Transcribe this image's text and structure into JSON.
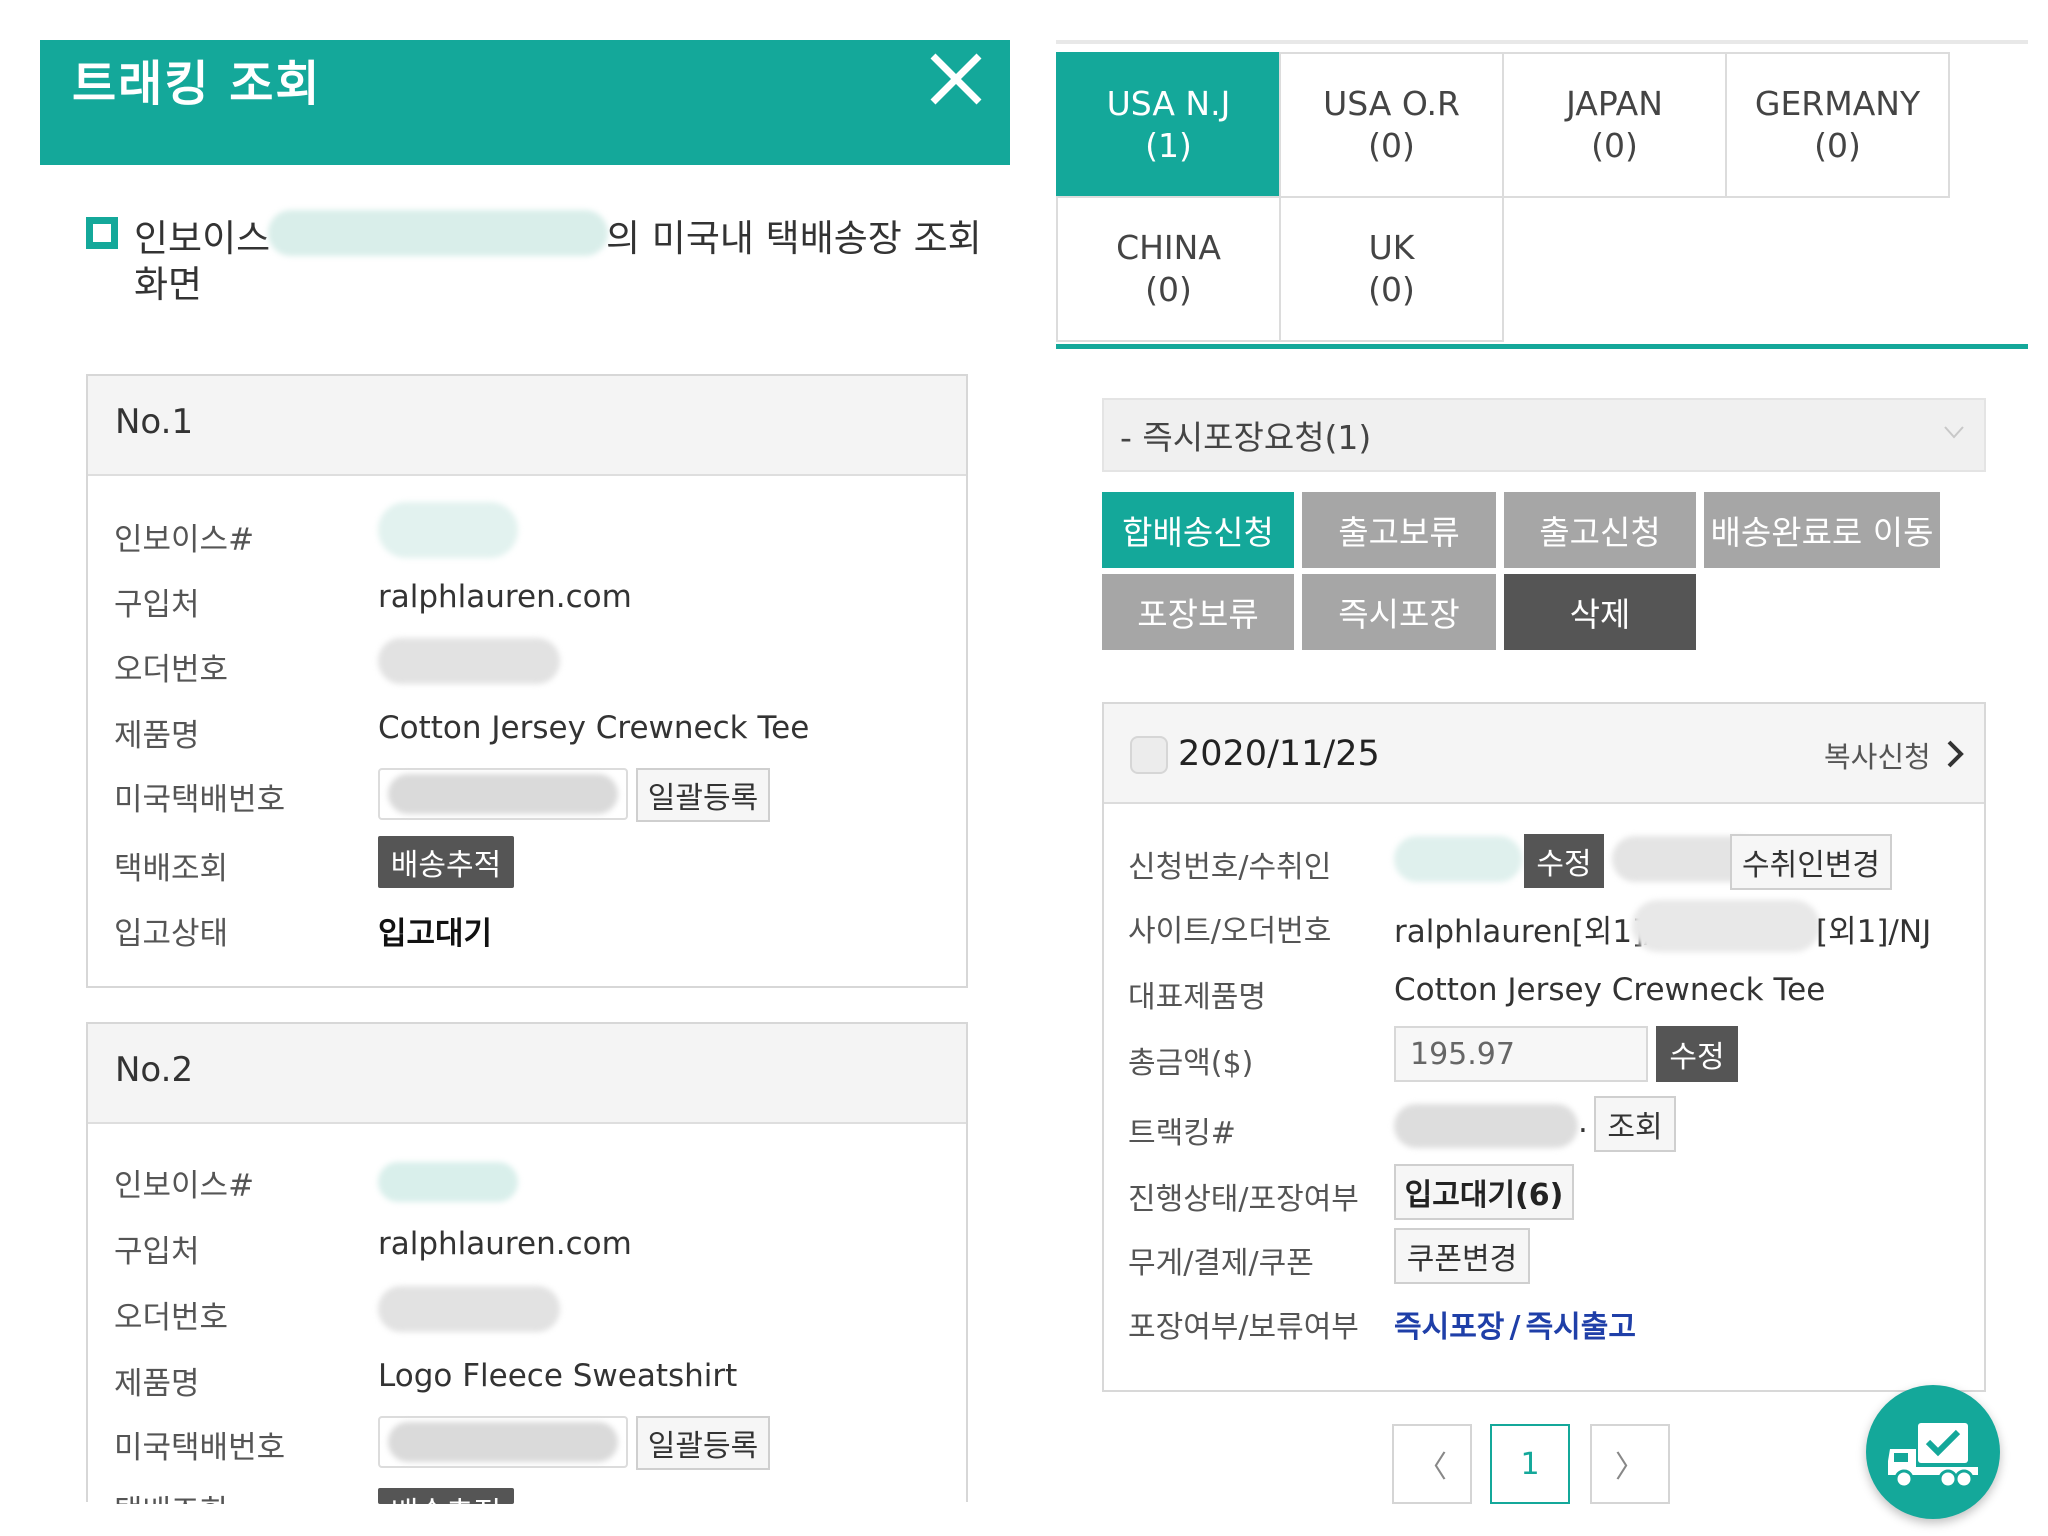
{
  "modal": {
    "title": "트래킹 조회",
    "info_prefix": "인보이스 ",
    "info_suffix": "의 미국내 택배송장 조회",
    "info_line2": "화면"
  },
  "cards": [
    {
      "no": "No.1",
      "labels": {
        "invoice": "인보이스#",
        "vendor": "구입처",
        "order": "오더번호",
        "product": "제품명",
        "us_tracking": "미국택배번호",
        "tracking_lookup": "택배조회",
        "status": "입고상태"
      },
      "vendor": "ralphlauren.com",
      "product": "Cotton Jersey Crewneck Tee",
      "bulk_btn": "일괄등록",
      "track_btn": "배송추적",
      "status": "입고대기"
    },
    {
      "no": "No.2",
      "labels": {
        "invoice": "인보이스#",
        "vendor": "구입처",
        "order": "오더번호",
        "product": "제품명",
        "us_tracking": "미국택배번호",
        "tracking_lookup": "택배조회"
      },
      "vendor": "ralphlauren.com",
      "product": "Logo Fleece Sweatshirt",
      "bulk_btn": "일괄등록",
      "track_btn": "배송추적"
    }
  ],
  "tabs": [
    {
      "name": "USA N.J",
      "count": "(1)",
      "active": true
    },
    {
      "name": "USA O.R",
      "count": "(0)"
    },
    {
      "name": "JAPAN",
      "count": "(0)"
    },
    {
      "name": "GERMANY",
      "count": "(0)"
    },
    {
      "name": "CHINA",
      "count": "(0)"
    },
    {
      "name": "UK",
      "count": "(0)"
    }
  ],
  "filter": {
    "selected": "- 즉시포장요청(1)"
  },
  "actions": [
    "합배송신청",
    "출고보류",
    "출고신청",
    "배송완료로 이동",
    "포장보류",
    "즉시포장",
    "삭제"
  ],
  "order": {
    "date": "2020/11/25",
    "copy_label": "복사신청",
    "labels": {
      "req": "신청번호/수취인",
      "site": "사이트/오더번호",
      "product": "대표제품명",
      "total": "총금액($)",
      "tracking": "트랙킹#",
      "status": "진행상태/포장여부",
      "weight": "무게/결제/쿠폰",
      "pack": "포장여부/보류여부"
    },
    "edit_btn": "수정",
    "change_recipient_btn": "수취인변경",
    "site_prefix": "ralphlauren[외1]/",
    "site_suffix": "[외1]/NJ",
    "product": "Cotton Jersey Crewneck Tee",
    "total_value": "195.97",
    "total_edit_btn": "수정",
    "tracking_dot": ".",
    "lookup_btn": "조회",
    "status_btn": "입고대기(6)",
    "coupon_btn": "쿠폰변경",
    "pack_link1": "즉시포장",
    "pack_sep": "/",
    "pack_link2": "즉시출고"
  },
  "pagination": {
    "prev": "〈",
    "current": "1",
    "next": "〉"
  },
  "colors": {
    "brand": "#14a89a",
    "action_gray": "#a6a6a6",
    "action_dark": "#555555",
    "link": "#1f3fa8"
  }
}
